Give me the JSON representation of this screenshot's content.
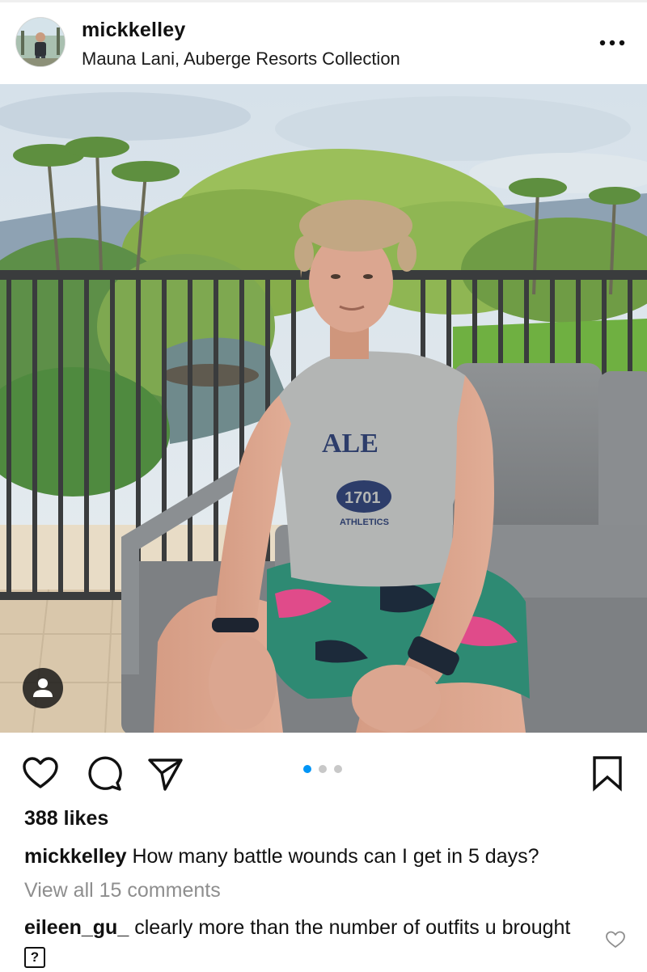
{
  "post": {
    "username": "mickkelley",
    "location": "Mauna Lani, Auberge Resorts Collection",
    "likes": "388 likes",
    "caption_user": "mickkelley",
    "caption_text": "How many battle wounds can I get in 5 days?",
    "view_all": "View all 15 comments",
    "comment_user": "eileen_gu_",
    "comment_text": "clearly more than the number of outfits u brought",
    "comment_emoji": "?"
  },
  "photo": {
    "shirt_text": "ALE",
    "shirt_number": "1701",
    "shirt_sub": "ATHLETICS"
  },
  "carousel": {
    "total": 3,
    "active": 1
  },
  "colors": {
    "active_dot": "#0095f6",
    "inactive_dot": "#c8c8c8",
    "muted_text": "#8e8e8e"
  },
  "icons": [
    "more-options-icon",
    "user-tag-icon",
    "heart-icon",
    "comment-icon",
    "share-icon",
    "bookmark-icon",
    "comment-like-heart-icon"
  ]
}
